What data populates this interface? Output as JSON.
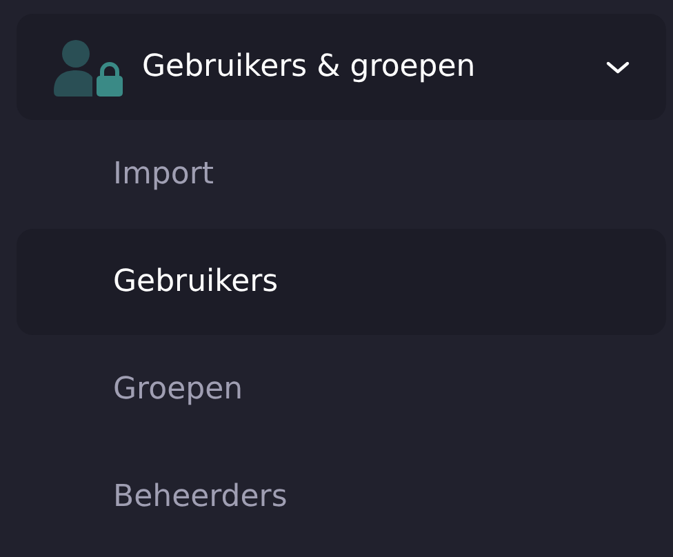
{
  "menu_group": {
    "label": "Gebruikers & groepen",
    "expanded": true,
    "items": [
      {
        "label": "Import",
        "selected": false
      },
      {
        "label": "Gebruikers",
        "selected": true
      },
      {
        "label": "Groepen",
        "selected": false
      },
      {
        "label": "Beheerders",
        "selected": false
      }
    ]
  }
}
